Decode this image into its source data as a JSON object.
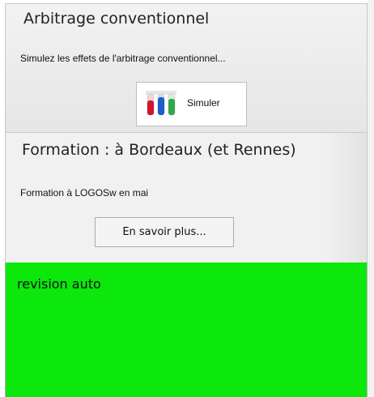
{
  "panels": {
    "arbitrage": {
      "title": "Arbitrage conventionnel",
      "description": "Simulez les effets de l'arbitrage conventionnel...",
      "button_label": "Simuler",
      "button_icon": "test-tubes-icon"
    },
    "formation": {
      "title": "Formation : à Bordeaux (et Rennes)",
      "description": "Formation à LOGOSw en mai",
      "button_label": "En savoir plus..."
    },
    "revision": {
      "title": "revision auto",
      "background": "#0ce80c"
    }
  }
}
